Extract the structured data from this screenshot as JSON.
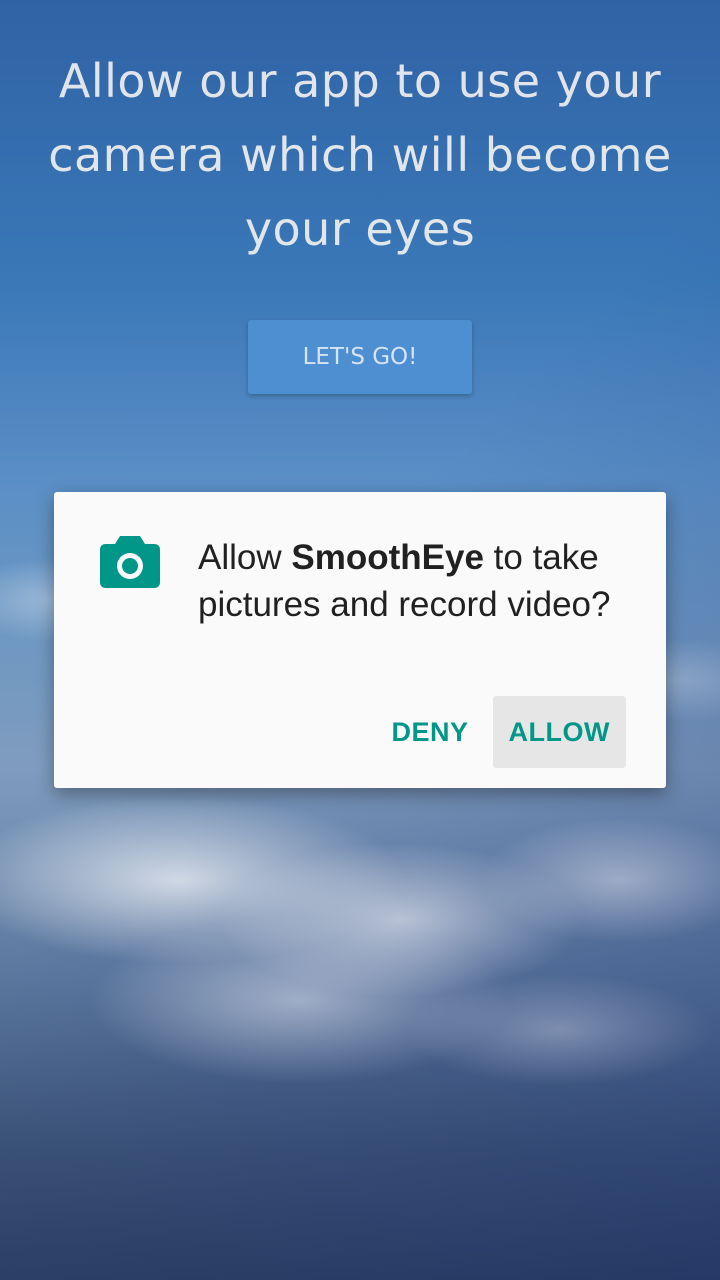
{
  "screen": {
    "headline": "Allow our app to use your camera which will become your eyes",
    "cta_label": "LET'S GO!"
  },
  "dialog": {
    "icon": "camera-icon",
    "message_prefix": "Allow",
    "app_name": "SmoothEye",
    "message_suffix": "to take pictures and record video?",
    "deny_label": "DENY",
    "allow_label": "ALLOW"
  },
  "colors": {
    "accent": "#009688",
    "cta_background": "#4d8fd0",
    "dialog_background": "#fafafa"
  }
}
